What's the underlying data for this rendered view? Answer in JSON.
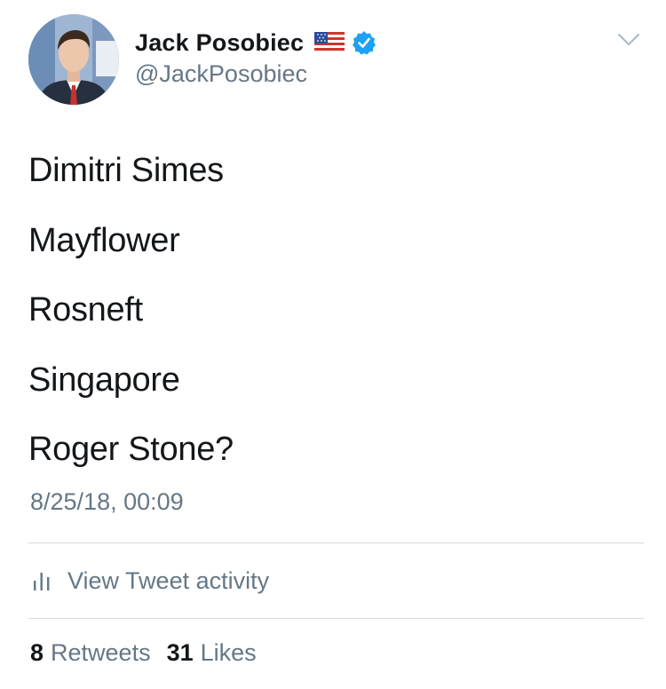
{
  "author": {
    "name": "Jack Posobiec",
    "handle": "@JackPosobiec",
    "avatar_icon": "profile-photo",
    "flag_icon": "us-flag-emoji",
    "verified_icon": "verified-badge-icon"
  },
  "tweet": {
    "lines": [
      "Dimitri Simes",
      "Mayflower",
      "Rosneft",
      "Singapore",
      "Roger Stone?"
    ],
    "timestamp": "8/25/18, 00:09"
  },
  "activity": {
    "icon": "bar-chart-icon",
    "label": "View Tweet activity"
  },
  "stats": {
    "retweets_count": "8",
    "retweets_label": "Retweets",
    "likes_count": "31",
    "likes_label": "Likes"
  },
  "colors": {
    "primary_text": "#14171a",
    "secondary_text": "#657786",
    "verified_blue": "#1da1f2",
    "divider": "#d6dbe0"
  }
}
